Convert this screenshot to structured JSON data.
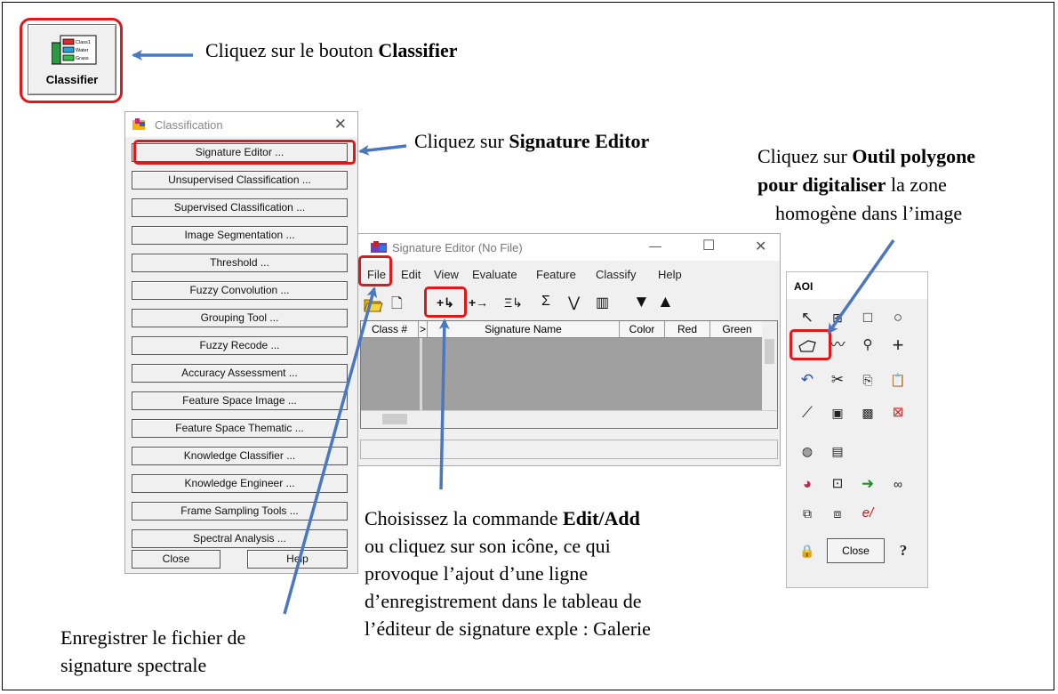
{
  "captions": {
    "classifier": {
      "prefix": "Cliquez sur le bouton ",
      "bold": "Classifier"
    },
    "signature_editor": {
      "prefix": "Cliquez sur ",
      "bold": "Signature Editor"
    },
    "polygon": {
      "line1_prefix": "Cliquez sur ",
      "line1_bold": "Outil polygone",
      "line2_bold": "pour digitaliser",
      "line2_rest": " la zone",
      "line3": "homogène dans l’image"
    },
    "edit_add": {
      "line1_prefix": "Choisissez la commande ",
      "line1_bold": "Edit/Add",
      "line2": "ou cliquez sur son icône, ce qui",
      "line3": "provoque l’ajout d’une ligne",
      "line4": "d’enregistrement dans le tableau de",
      "line5": "l’éditeur de signature exple : Galerie"
    },
    "save": {
      "line1": "Enregistrer le fichier de",
      "line2": "signature spectrale"
    }
  },
  "classifier_button": {
    "label": "Classifier",
    "icon_rows": [
      "Class1",
      "Water",
      "Grass"
    ]
  },
  "classification_window": {
    "title": "Classification",
    "close_glyph": "✕",
    "buttons": [
      "Signature Editor ...",
      "Unsupervised Classification ...",
      "Supervised Classification ...",
      "Image Segmentation ...",
      "Threshold ...",
      "Fuzzy Convolution ...",
      "Grouping Tool ...",
      "Fuzzy Recode ...",
      "Accuracy Assessment ...",
      "Feature Space Image ...",
      "Feature Space Thematic ...",
      "Knowledge Classifier ...",
      "Knowledge Engineer ...",
      "Frame Sampling Tools ...",
      "Spectral Analysis ..."
    ],
    "close_label": "Close",
    "help_label": "Help"
  },
  "signature_editor": {
    "title": "Signature Editor (No File)",
    "controls": {
      "minimize": "—",
      "maximize": "☐",
      "close": "✕"
    },
    "menu": [
      "File",
      "Edit",
      "View",
      "Evaluate",
      "Feature",
      "Classify",
      "Help"
    ],
    "toolbar": {
      "new": "🗋",
      "add": "+↳",
      "replace": "+→",
      "merge": "Ξ↳",
      "stats": "Σ",
      "line": "⋁",
      "hist": "▥",
      "down": "▼",
      "up": "▲"
    },
    "columns": [
      "Class #",
      ">",
      "Signature Name",
      "Color",
      "Red",
      "Green"
    ]
  },
  "aoi": {
    "title": "AOI",
    "close_label": "Close",
    "help_glyph": "?"
  },
  "colors": {
    "highlight": "#e0171b",
    "arrow": "#4a78c0"
  }
}
